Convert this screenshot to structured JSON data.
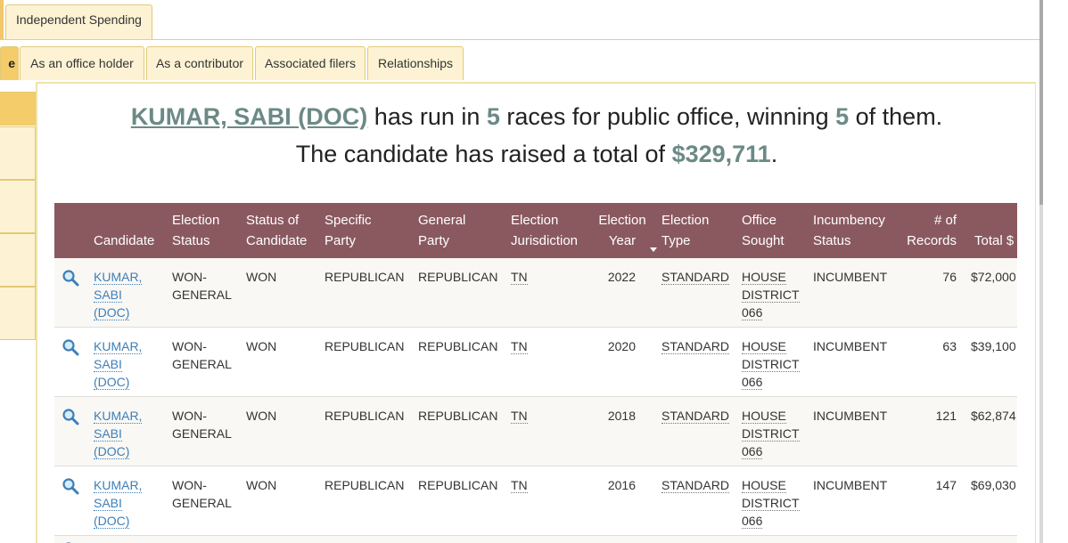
{
  "top_tabs": [
    {
      "label": "Independent Spending"
    }
  ],
  "sub_tabs": [
    {
      "label": "e"
    },
    {
      "label": "As an office holder"
    },
    {
      "label": "As a contributor"
    },
    {
      "label": "Associated filers"
    },
    {
      "label": "Relationships"
    }
  ],
  "summary": {
    "candidate": "KUMAR, SABI (DOC)",
    "text1": " has run in ",
    "races": "5",
    "text2": " races for public office, winning ",
    "wins": "5",
    "text3": " of them.",
    "text4": "The candidate has raised a total of ",
    "total": "$329,711",
    "text5": "."
  },
  "table": {
    "headers": {
      "candidate": "Candidate",
      "election_status_1": "Election",
      "election_status_2": "Status",
      "status_of_candidate_1": "Status of",
      "status_of_candidate_2": "Candidate",
      "specific_party_1": "Specific",
      "specific_party_2": "Party",
      "general_party_1": "General",
      "general_party_2": "Party",
      "jurisdiction_1": "Election",
      "jurisdiction_2": "Jurisdiction",
      "year_1": "Election",
      "year_2": "Year",
      "type_1": "Election",
      "type_2": "Type",
      "office_1": "Office",
      "office_2": "Sought",
      "incumbency_1": "Incumbency",
      "incumbency_2": "Status",
      "records_1": "# of",
      "records_2": "Records",
      "total": "Total $"
    },
    "rows": [
      {
        "cand_1": "KUMAR,",
        "cand_2": "SABI",
        "cand_3": "(DOC)",
        "election_status_1": "WON-",
        "election_status_2": "GENERAL",
        "status": "WON",
        "specific_party": "REPUBLICAN",
        "general_party": "REPUBLICAN",
        "jurisdiction": "TN",
        "year": "2022",
        "type": "STANDARD",
        "office_1": "HOUSE",
        "office_2": "DISTRICT",
        "office_3": "066",
        "incumbency": "INCUMBENT",
        "records": "76",
        "total": "$72,000"
      },
      {
        "cand_1": "KUMAR,",
        "cand_2": "SABI",
        "cand_3": "(DOC)",
        "election_status_1": "WON-",
        "election_status_2": "GENERAL",
        "status": "WON",
        "specific_party": "REPUBLICAN",
        "general_party": "REPUBLICAN",
        "jurisdiction": "TN",
        "year": "2020",
        "type": "STANDARD",
        "office_1": "HOUSE",
        "office_2": "DISTRICT",
        "office_3": "066",
        "incumbency": "INCUMBENT",
        "records": "63",
        "total": "$39,100"
      },
      {
        "cand_1": "KUMAR,",
        "cand_2": "SABI",
        "cand_3": "(DOC)",
        "election_status_1": "WON-",
        "election_status_2": "GENERAL",
        "status": "WON",
        "specific_party": "REPUBLICAN",
        "general_party": "REPUBLICAN",
        "jurisdiction": "TN",
        "year": "2018",
        "type": "STANDARD",
        "office_1": "HOUSE",
        "office_2": "DISTRICT",
        "office_3": "066",
        "incumbency": "INCUMBENT",
        "records": "121",
        "total": "$62,874"
      },
      {
        "cand_1": "KUMAR,",
        "cand_2": "SABI",
        "cand_3": "(DOC)",
        "election_status_1": "WON-",
        "election_status_2": "GENERAL",
        "status": "WON",
        "specific_party": "REPUBLICAN",
        "general_party": "REPUBLICAN",
        "jurisdiction": "TN",
        "year": "2016",
        "type": "STANDARD",
        "office_1": "HOUSE",
        "office_2": "DISTRICT",
        "office_3": "066",
        "incumbency": "INCUMBENT",
        "records": "147",
        "total": "$69,030"
      }
    ]
  },
  "colors": {
    "header_bg": "#8a5960",
    "highlight": "#6b8a86",
    "tab_bg": "#fdf3d4",
    "tab_active": "#f5cc6a",
    "link": "#3d7fb8"
  },
  "icons": {
    "row_action": "magnifier-icon",
    "sort": "sort-down-icon"
  }
}
